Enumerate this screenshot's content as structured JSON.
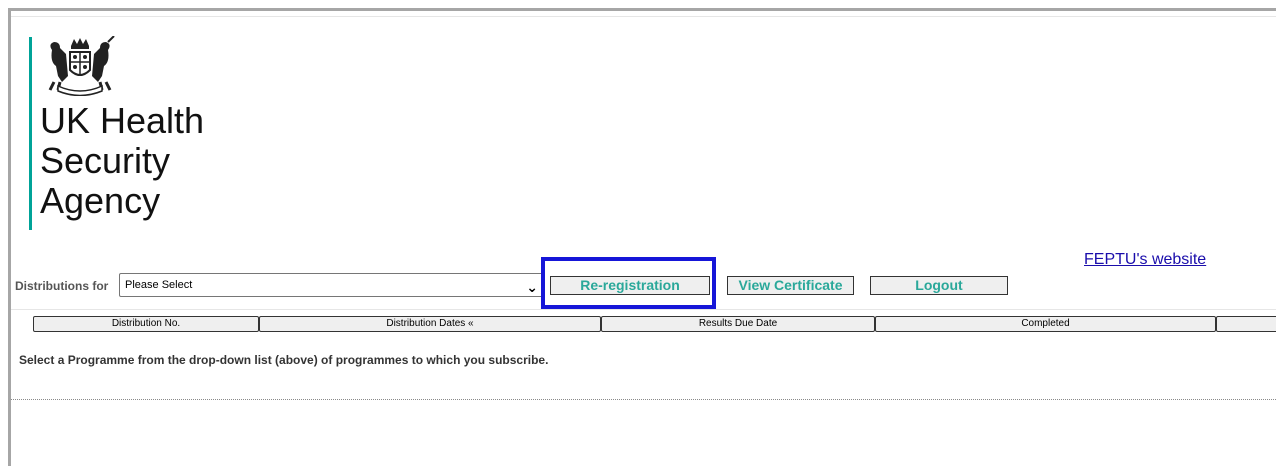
{
  "header": {
    "agency_name_line1": "UK Health",
    "agency_name_line2": "Security",
    "agency_name_line3": "Agency",
    "website_link": "FEPTU's website"
  },
  "toolbar": {
    "distributions_label": "Distributions for",
    "select_value": "Please Select",
    "reregistration_label": "Re-registration",
    "view_certificate_label": "View Certificate",
    "logout_label": "Logout"
  },
  "table": {
    "columns": [
      "Distribution No.",
      "Distribution Dates «",
      "Results Due Date",
      "Completed",
      ""
    ]
  },
  "message": "Select a Programme from the drop-down list (above) of programmes to which you subscribe.",
  "colors": {
    "accent_teal": "#00a398",
    "button_text": "#2aa89a",
    "link": "#1a0dab",
    "highlight_border": "#1616d8"
  },
  "icons": {
    "crest": "royal-coat-of-arms-icon",
    "select_chevron": "chevron-down-icon"
  }
}
